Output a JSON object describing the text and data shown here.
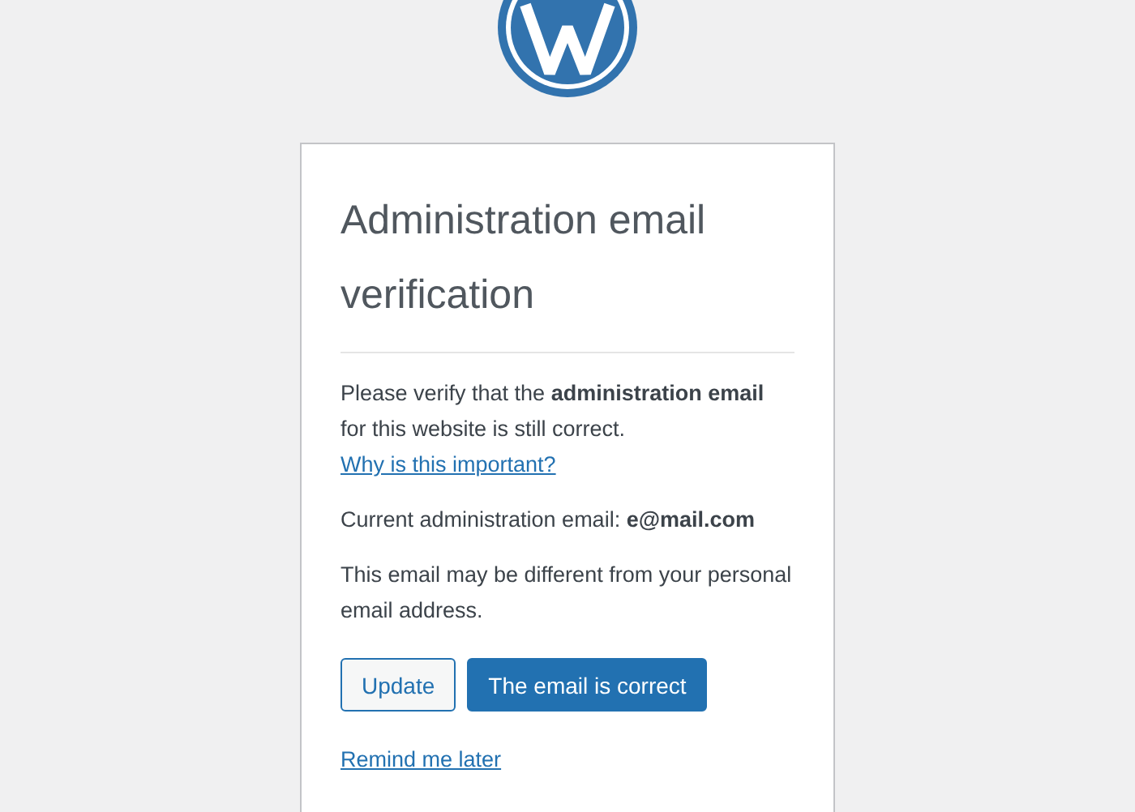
{
  "card": {
    "title": "Administration email verification",
    "intro": {
      "text": "Please verify that the **administration email** for this website is still correct. ",
      "link": "Why is this important?"
    },
    "current_email": {
      "label": "Current administration email: ",
      "value": "e@mail.com"
    },
    "note": "This email may be different from your personal email address.",
    "buttons": [
      {
        "label": "Update",
        "kind": "secondary"
      },
      {
        "label": "The email is correct",
        "kind": "primary"
      }
    ],
    "remind_link": "Remind me later"
  }
}
